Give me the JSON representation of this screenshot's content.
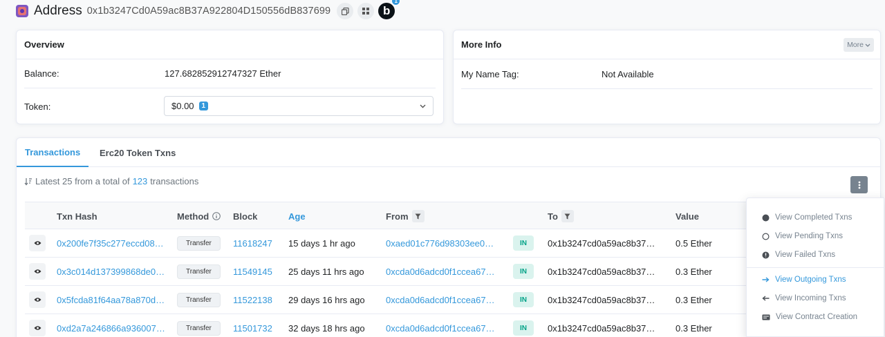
{
  "header": {
    "title": "Address",
    "address": "0x1b3247Cd0A59ac8B37A922804D150556dB837699",
    "blockscan_letter": "b",
    "blockscan_badge": "1"
  },
  "overview": {
    "title": "Overview",
    "balance_label": "Balance:",
    "balance_value": "127.682852912747327 Ether",
    "token_label": "Token:",
    "token_value": "$0.00",
    "token_count": "1"
  },
  "more_info": {
    "title": "More Info",
    "more_button": "More",
    "name_tag_label": "My Name Tag:",
    "name_tag_value": "Not Available"
  },
  "tabs": [
    {
      "label": "Transactions",
      "active": true
    },
    {
      "label": "Erc20 Token Txns",
      "active": false
    }
  ],
  "summary": {
    "prefix": "Latest 25 from a total of",
    "count": "123",
    "suffix": "transactions"
  },
  "table": {
    "headers": [
      "Txn Hash",
      "Method",
      "Block",
      "Age",
      "From",
      "To",
      "Value"
    ],
    "rows": [
      {
        "hash": "0x200fe7f35c277eccd08…",
        "method": "Transfer",
        "block": "11618247",
        "age": "15 days 1 hr ago",
        "from": "0xaed01c776d98303ee0…",
        "dir": "IN",
        "to": "0x1b3247cd0a59ac8b37…",
        "value": "0.5 Ether"
      },
      {
        "hash": "0x3c014d137399868de0…",
        "method": "Transfer",
        "block": "11549145",
        "age": "25 days 11 hrs ago",
        "from": "0xcda0d6adcd0f1ccea67…",
        "dir": "IN",
        "to": "0x1b3247cd0a59ac8b37…",
        "value": "0.3 Ether"
      },
      {
        "hash": "0x5fcda81f64aa78a870d…",
        "method": "Transfer",
        "block": "11522138",
        "age": "29 days 16 hrs ago",
        "from": "0xcda0d6adcd0f1ccea67…",
        "dir": "IN",
        "to": "0x1b3247cd0a59ac8b37…",
        "value": "0.3 Ether"
      },
      {
        "hash": "0xd2a7a246866a936007…",
        "method": "Transfer",
        "block": "11501732",
        "age": "32 days 18 hrs ago",
        "from": "0xcda0d6adcd0f1ccea67…",
        "dir": "IN",
        "to": "0x1b3247cd0a59ac8b37…",
        "value": "0.3 Ether"
      }
    ]
  },
  "dropdown": {
    "items": [
      {
        "label": "View Completed Txns",
        "icon": "filled-circle-icon"
      },
      {
        "label": "View Pending Txns",
        "icon": "hollow-circle-icon"
      },
      {
        "label": "View Failed Txns",
        "icon": "exclamation-circle-icon"
      },
      {
        "label": "View Outgoing Txns",
        "icon": "arrow-right-icon"
      },
      {
        "label": "View Incoming Txns",
        "icon": "arrow-left-icon"
      },
      {
        "label": "View Contract Creation",
        "icon": "card-icon"
      }
    ]
  },
  "colors": {
    "accent": "#3498db",
    "in_badge_bg": "#daf3ee",
    "in_badge_text": "#00a186"
  }
}
